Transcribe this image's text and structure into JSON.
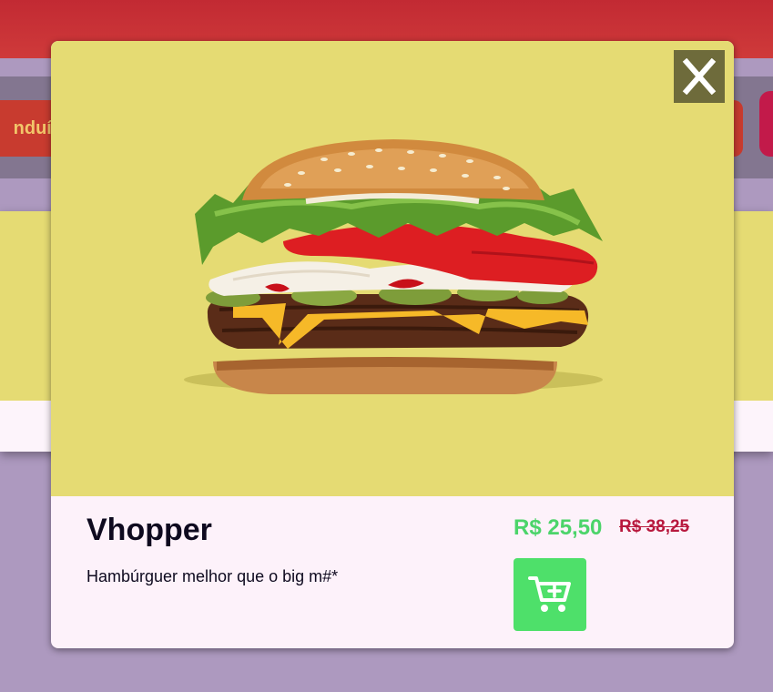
{
  "background": {
    "category_partial_label": "nduíc"
  },
  "modal": {
    "close_label": "X",
    "product": {
      "name": "Vhopper",
      "description": "Hambúrguer melhor que o big m#*",
      "price": "R$ 25,50",
      "old_price": "R$ 38,25",
      "image_icon": "burger-image"
    },
    "add_to_cart_icon": "cart-plus-icon"
  },
  "colors": {
    "modal_image_bg": "#e5db73",
    "price_green": "#4cd46a",
    "old_price_red": "#b8193e",
    "cart_button": "#4ee06a",
    "close_button": "#6e6b3b",
    "header_red": "#c22a33",
    "page_bg": "#ad99bf"
  }
}
